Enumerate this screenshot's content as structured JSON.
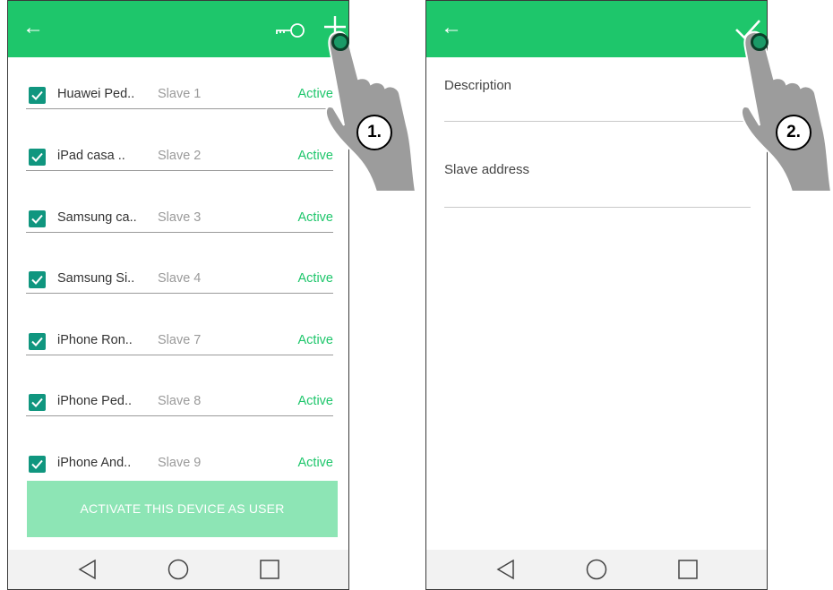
{
  "screen1": {
    "devices": [
      {
        "name": "Huawei Ped..",
        "slave": "Slave 1",
        "status": "Active"
      },
      {
        "name": "iPad casa ..",
        "slave": "Slave 2",
        "status": "Active"
      },
      {
        "name": "Samsung ca..",
        "slave": "Slave 3",
        "status": "Active"
      },
      {
        "name": "Samsung Si..",
        "slave": "Slave 4",
        "status": "Active"
      },
      {
        "name": "iPhone Ron..",
        "slave": "Slave 7",
        "status": "Active"
      },
      {
        "name": "iPhone Ped..",
        "slave": "Slave 8",
        "status": "Active"
      },
      {
        "name": "iPhone And..",
        "slave": "Slave 9",
        "status": "Active"
      }
    ],
    "activate_button": "ACTIVATE THIS DEVICE AS USER",
    "step_label": "1."
  },
  "screen2": {
    "description_label": "Description",
    "slave_address_label": "Slave address",
    "step_label": "2."
  },
  "colors": {
    "accent": "#1ec66b",
    "checkbox": "#10967f",
    "button_disabled": "#8de5b5"
  },
  "icons": [
    "back-arrow-icon",
    "key-icon",
    "plus-icon",
    "checkmark-icon",
    "nav-back-icon",
    "nav-home-icon",
    "nav-recents-icon",
    "pointing-hand-icon"
  ]
}
